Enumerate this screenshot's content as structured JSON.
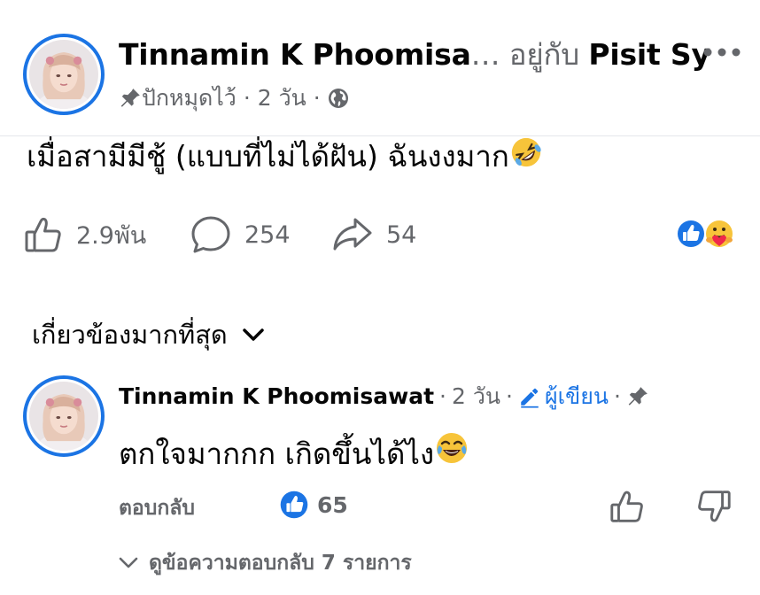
{
  "post": {
    "author": "Tinnamin K Phoomisa",
    "author_ellipsis": "…",
    "with_word": "อยู่กับ",
    "with_name": "Pisit Sy",
    "pinned_label": "ปักหมุดไว้",
    "separator": "·",
    "time": "2 วัน",
    "audience_icon": "globe-icon",
    "text": "เมื่อสามีมีชู้ (แบบที่ไม่ได้ฝัน) ฉันงงมาก",
    "text_emoji": "rolling-on-floor-laughing-emoji"
  },
  "actions": {
    "like_count": "2.9พัน",
    "comment_count": "254",
    "share_count": "54",
    "reactions": [
      "like",
      "care"
    ]
  },
  "sort": {
    "label": "เกี่ยวข้องมากที่สุด"
  },
  "comment": {
    "author": "Tinnamin K Phoomisawat",
    "separator": "·",
    "time": "2 วัน",
    "author_badge": "ผู้เขียน",
    "text": "ตกใจมากกก เกิดขึ้นได้ไง",
    "text_emoji": "face-with-tears-of-joy-emoji",
    "reply_label": "ตอบกลับ",
    "like_count": "65",
    "view_replies": "ดูข้อความตอบกลับ 7 รายการ"
  },
  "colors": {
    "accent": "#1b74e4",
    "secondary_text": "#65676b",
    "primary_text": "#050505"
  }
}
